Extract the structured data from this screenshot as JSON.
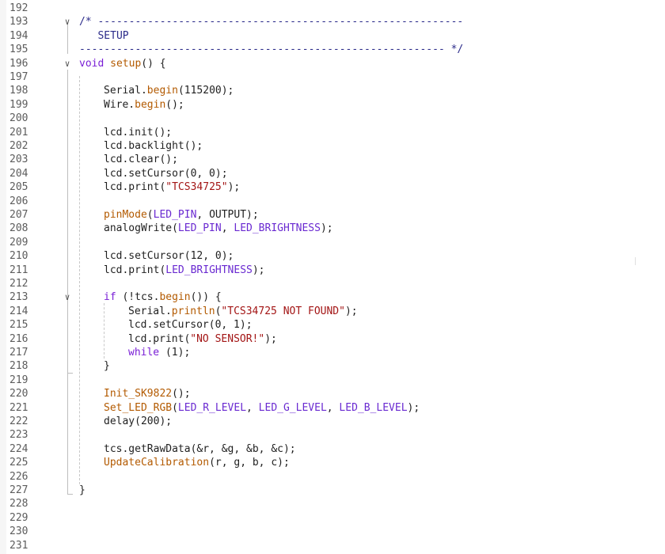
{
  "editor": {
    "language": "Arduino C++",
    "colors": {
      "keyword": "#7a1fd6",
      "function": "#b35a00",
      "string": "#a31515",
      "comment": "#2b2b8a",
      "macro": "#6a2ad1",
      "line_number": "#5c5c5c"
    },
    "lines": [
      {
        "num": "192",
        "fold": "",
        "indent": 0,
        "tokens": []
      },
      {
        "num": "193",
        "fold": "v",
        "indent": 0,
        "tokens": [
          {
            "t": "cm",
            "v": "/* -----------------------------------------------------------"
          }
        ]
      },
      {
        "num": "194",
        "fold": "",
        "indent": 0,
        "tokens": [
          {
            "t": "cm",
            "v": "   SETUP"
          }
        ]
      },
      {
        "num": "195",
        "fold": "",
        "indent": 0,
        "tokens": [
          {
            "t": "cm",
            "v": "----------------------------------------------------------- */"
          }
        ]
      },
      {
        "num": "196",
        "fold": "v",
        "indent": 0,
        "tokens": [
          {
            "t": "kw",
            "v": "void"
          },
          {
            "t": "plain",
            "v": " "
          },
          {
            "t": "fn",
            "v": "setup"
          },
          {
            "t": "plain",
            "v": "() {"
          }
        ]
      },
      {
        "num": "197",
        "fold": "",
        "indent": 0,
        "tokens": []
      },
      {
        "num": "198",
        "fold": "",
        "indent": 1,
        "tokens": [
          {
            "t": "plain",
            "v": "Serial."
          },
          {
            "t": "fn",
            "v": "begin"
          },
          {
            "t": "plain",
            "v": "(115200);"
          }
        ]
      },
      {
        "num": "199",
        "fold": "",
        "indent": 1,
        "tokens": [
          {
            "t": "plain",
            "v": "Wire."
          },
          {
            "t": "fn",
            "v": "begin"
          },
          {
            "t": "plain",
            "v": "();"
          }
        ]
      },
      {
        "num": "200",
        "fold": "",
        "indent": 0,
        "tokens": []
      },
      {
        "num": "201",
        "fold": "",
        "indent": 1,
        "tokens": [
          {
            "t": "plain",
            "v": "lcd.init();"
          }
        ]
      },
      {
        "num": "202",
        "fold": "",
        "indent": 1,
        "tokens": [
          {
            "t": "plain",
            "v": "lcd.backlight();"
          }
        ]
      },
      {
        "num": "203",
        "fold": "",
        "indent": 1,
        "tokens": [
          {
            "t": "plain",
            "v": "lcd.clear();"
          }
        ]
      },
      {
        "num": "204",
        "fold": "",
        "indent": 1,
        "tokens": [
          {
            "t": "plain",
            "v": "lcd.setCursor(0, 0);"
          }
        ]
      },
      {
        "num": "205",
        "fold": "",
        "indent": 1,
        "tokens": [
          {
            "t": "plain",
            "v": "lcd.print("
          },
          {
            "t": "str",
            "v": "\"TCS34725\""
          },
          {
            "t": "plain",
            "v": ");"
          }
        ]
      },
      {
        "num": "206",
        "fold": "",
        "indent": 0,
        "tokens": []
      },
      {
        "num": "207",
        "fold": "",
        "indent": 1,
        "tokens": [
          {
            "t": "fn",
            "v": "pinMode"
          },
          {
            "t": "plain",
            "v": "("
          },
          {
            "t": "macro",
            "v": "LED_PIN"
          },
          {
            "t": "plain",
            "v": ", OUTPUT);"
          }
        ]
      },
      {
        "num": "208",
        "fold": "",
        "indent": 1,
        "tokens": [
          {
            "t": "plain",
            "v": "analogWrite("
          },
          {
            "t": "macro",
            "v": "LED_PIN"
          },
          {
            "t": "plain",
            "v": ", "
          },
          {
            "t": "macro",
            "v": "LED_BRIGHTNESS"
          },
          {
            "t": "plain",
            "v": ");"
          }
        ]
      },
      {
        "num": "209",
        "fold": "",
        "indent": 0,
        "tokens": []
      },
      {
        "num": "210",
        "fold": "",
        "indent": 1,
        "tokens": [
          {
            "t": "plain",
            "v": "lcd.setCursor(12, 0);"
          }
        ]
      },
      {
        "num": "211",
        "fold": "",
        "indent": 1,
        "tokens": [
          {
            "t": "plain",
            "v": "lcd.print("
          },
          {
            "t": "macro",
            "v": "LED_BRIGHTNESS"
          },
          {
            "t": "plain",
            "v": ");"
          }
        ]
      },
      {
        "num": "212",
        "fold": "",
        "indent": 0,
        "tokens": []
      },
      {
        "num": "213",
        "fold": "v",
        "indent": 1,
        "tokens": [
          {
            "t": "kw",
            "v": "if"
          },
          {
            "t": "plain",
            "v": " (!tcs."
          },
          {
            "t": "fn",
            "v": "begin"
          },
          {
            "t": "plain",
            "v": "()) {"
          }
        ]
      },
      {
        "num": "214",
        "fold": "",
        "indent": 2,
        "tokens": [
          {
            "t": "plain",
            "v": "Serial."
          },
          {
            "t": "fn",
            "v": "println"
          },
          {
            "t": "plain",
            "v": "("
          },
          {
            "t": "str",
            "v": "\"TCS34725 NOT FOUND\""
          },
          {
            "t": "plain",
            "v": ");"
          }
        ]
      },
      {
        "num": "215",
        "fold": "",
        "indent": 2,
        "tokens": [
          {
            "t": "plain",
            "v": "lcd.setCursor(0, 1);"
          }
        ]
      },
      {
        "num": "216",
        "fold": "",
        "indent": 2,
        "tokens": [
          {
            "t": "plain",
            "v": "lcd.print("
          },
          {
            "t": "str",
            "v": "\"NO SENSOR!\""
          },
          {
            "t": "plain",
            "v": ");"
          }
        ]
      },
      {
        "num": "217",
        "fold": "",
        "indent": 2,
        "tokens": [
          {
            "t": "kw",
            "v": "while"
          },
          {
            "t": "plain",
            "v": " (1);"
          }
        ]
      },
      {
        "num": "218",
        "fold": "",
        "indent": 1,
        "tokens": [
          {
            "t": "plain",
            "v": "}"
          }
        ]
      },
      {
        "num": "219",
        "fold": "",
        "indent": 0,
        "tokens": []
      },
      {
        "num": "220",
        "fold": "",
        "indent": 1,
        "tokens": [
          {
            "t": "fn",
            "v": "Init_SK9822"
          },
          {
            "t": "plain",
            "v": "();"
          }
        ]
      },
      {
        "num": "221",
        "fold": "",
        "indent": 1,
        "tokens": [
          {
            "t": "fn",
            "v": "Set_LED_RGB"
          },
          {
            "t": "plain",
            "v": "("
          },
          {
            "t": "macro",
            "v": "LED_R_LEVEL"
          },
          {
            "t": "plain",
            "v": ", "
          },
          {
            "t": "macro",
            "v": "LED_G_LEVEL"
          },
          {
            "t": "plain",
            "v": ", "
          },
          {
            "t": "macro",
            "v": "LED_B_LEVEL"
          },
          {
            "t": "plain",
            "v": ");"
          }
        ]
      },
      {
        "num": "222",
        "fold": "",
        "indent": 1,
        "tokens": [
          {
            "t": "plain",
            "v": "delay(200);"
          }
        ]
      },
      {
        "num": "223",
        "fold": "",
        "indent": 0,
        "tokens": []
      },
      {
        "num": "224",
        "fold": "",
        "indent": 1,
        "tokens": [
          {
            "t": "plain",
            "v": "tcs.getRawData(&r, &g, &b, &c);"
          }
        ]
      },
      {
        "num": "225",
        "fold": "",
        "indent": 1,
        "tokens": [
          {
            "t": "fn",
            "v": "UpdateCalibration"
          },
          {
            "t": "plain",
            "v": "(r, g, b, c);"
          }
        ]
      },
      {
        "num": "226",
        "fold": "",
        "indent": 0,
        "tokens": []
      },
      {
        "num": "227",
        "fold": "",
        "indent": 0,
        "tokens": [
          {
            "t": "plain",
            "v": "}"
          }
        ]
      },
      {
        "num": "228",
        "fold": "",
        "indent": 0,
        "tokens": []
      },
      {
        "num": "229",
        "fold": "",
        "indent": 0,
        "tokens": []
      },
      {
        "num": "230",
        "fold": "",
        "indent": 0,
        "tokens": []
      },
      {
        "num": "231",
        "fold": "",
        "indent": 0,
        "tokens": []
      }
    ]
  }
}
